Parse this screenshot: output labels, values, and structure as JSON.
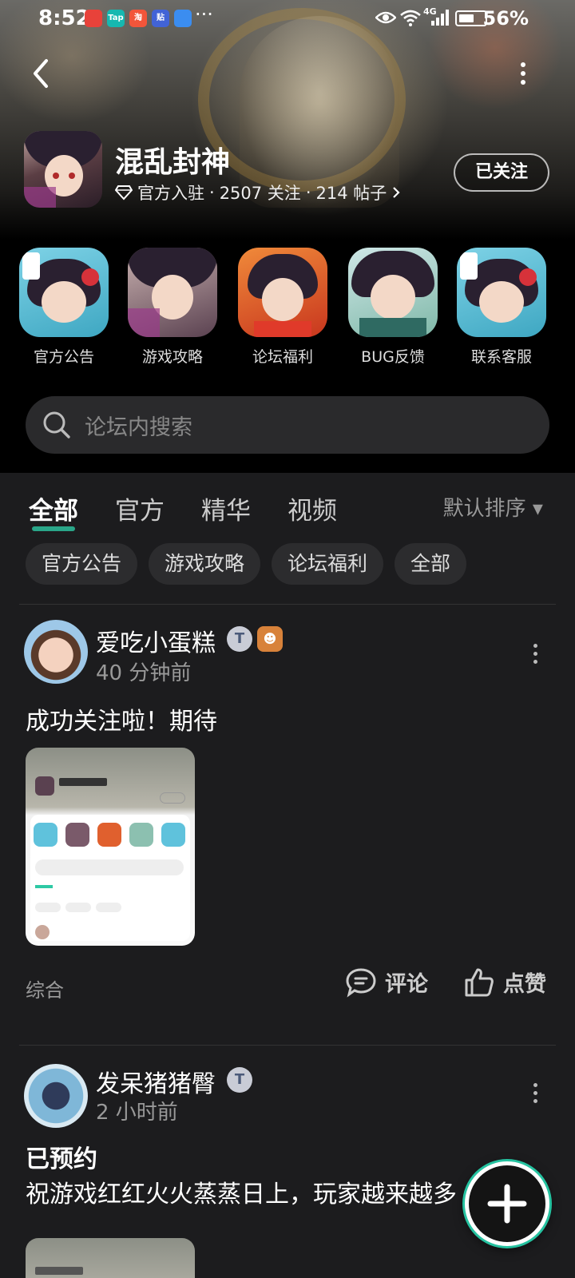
{
  "status_bar": {
    "time": "8:52",
    "battery": "56%",
    "notif_app_labels": [
      "",
      "Tap",
      "淘",
      "贴",
      ""
    ],
    "notif_more": "···",
    "network_label": "4G"
  },
  "game": {
    "name": "混乱封神",
    "verified_label": "官方入驻",
    "followers": "2507 关注",
    "posts": "214 帖子",
    "separator": "·",
    "follow_button": "已关注"
  },
  "quick_entries": [
    {
      "label": "官方公告"
    },
    {
      "label": "游戏攻略"
    },
    {
      "label": "论坛福利"
    },
    {
      "label": "BUG反馈"
    },
    {
      "label": "联系客服"
    }
  ],
  "search": {
    "placeholder": "论坛内搜索"
  },
  "tabs": [
    {
      "label": "全部",
      "active": true
    },
    {
      "label": "官方",
      "active": false
    },
    {
      "label": "精华",
      "active": false
    },
    {
      "label": "视频",
      "active": false
    }
  ],
  "sort": {
    "label": "默认排序 ▾"
  },
  "chips": [
    {
      "label": "官方公告"
    },
    {
      "label": "游戏攻略"
    },
    {
      "label": "论坛福利"
    },
    {
      "label": "全部"
    }
  ],
  "posts": [
    {
      "author": "爱吃小蛋糕",
      "time": "40 分钟前",
      "level_badge": "T",
      "text": "成功关注啦！期待",
      "category": "综合",
      "comment_label": "评论",
      "like_label": "点赞"
    },
    {
      "author": "发呆猪猪臀",
      "time": "2 小时前",
      "level_badge": "T",
      "title": "已预约",
      "text": "祝游戏红红火火蒸蒸日上，玩家越来越多"
    }
  ],
  "colors": {
    "accent": "#2ec9a4",
    "background": "#1c1c1e",
    "chip_bg": "#2c2c2e"
  },
  "icons": {
    "back": "chevron-left-icon",
    "more": "more-vertical-icon",
    "verified": "diamond-icon",
    "search": "search-icon",
    "comment": "comment-icon",
    "like": "thumbs-up-icon",
    "fab": "plus-icon"
  }
}
